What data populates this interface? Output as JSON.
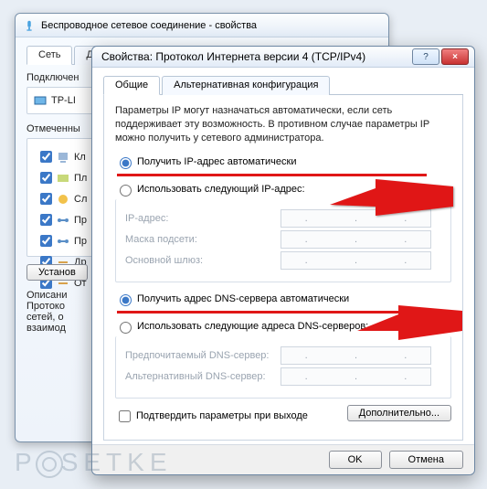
{
  "back_window": {
    "title": "Беспроводное сетевое соединение - свойства",
    "tabs": {
      "active": "Сеть",
      "other": "До"
    },
    "connect_label": "Подключен",
    "adapter": "TP-LI",
    "checked_label": "Отмеченны",
    "items": [
      {
        "label": "Кл"
      },
      {
        "label": "Пл"
      },
      {
        "label": "Сл"
      },
      {
        "label": "Пр"
      },
      {
        "label": "Пр"
      },
      {
        "label": "Др"
      },
      {
        "label": "От"
      }
    ],
    "install_btn": "Установ",
    "desc_title": "Описани",
    "desc_lines": "Протоко\nсетей, о\nвзаимод"
  },
  "front_window": {
    "title": "Свойства: Протокол Интернета версии 4 (TCP/IPv4)",
    "help_btn": "?",
    "close_btn": "×",
    "tabs": {
      "active": "Общие",
      "alt": "Альтернативная конфигурация"
    },
    "description": "Параметры IP могут назначаться автоматически, если сеть поддерживает эту возможность. В противном случае параметры IP можно получить у сетевого администратора.",
    "ip_group": {
      "auto": "Получить IP-адрес автоматически",
      "manual": "Использовать следующий IP-адрес:",
      "ip_label": "IP-адрес:",
      "mask_label": "Маска подсети:",
      "gw_label": "Основной шлюз:"
    },
    "dns_group": {
      "auto": "Получить адрес DNS-сервера автоматически",
      "manual": "Использовать следующие адреса DNS-серверов:",
      "pref_label": "Предпочитаемый DNS-сервер:",
      "alt_label": "Альтернативный DNS-сервер:"
    },
    "confirm_label": "Подтвердить параметры при выходе",
    "advanced_btn": "Дополнительно...",
    "ok_btn": "OK",
    "cancel_btn": "Отмена"
  },
  "watermark": {
    "before": "P",
    "after": "SETKE"
  }
}
